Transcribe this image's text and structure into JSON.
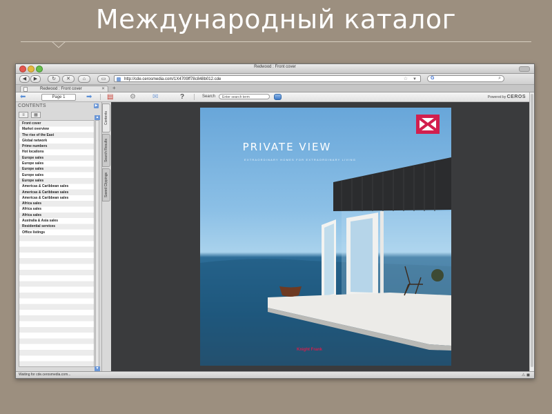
{
  "slide": {
    "title": "Международный каталог"
  },
  "browser": {
    "window_title": "Redwood : Front cover",
    "url": "http://cde.cerosmedia.com/1X4709ff78c848b012.cde",
    "tab_title": "Redwood : Front cover",
    "status": "Waiting for cde.cerosmedia.com..."
  },
  "toolbar": {
    "page_field": "Page 1",
    "search_label": "Search",
    "search_placeholder": "Enter search term",
    "powered_by": "Powered by",
    "powered_brand": "CEROS"
  },
  "sidebar": {
    "heading": "CONTENTS",
    "items": [
      "Front cover",
      "Market overview",
      "The rise of the East",
      "Global network",
      "Prime numbers",
      "Hot locations",
      "Europe sales",
      "Europe sales",
      "Europe sales",
      "Europe sales",
      "Europe sales",
      "Americas & Caribbean sales",
      "Americas & Caribbean sales",
      "Americas & Caribbean sales",
      "Africa sales",
      "Africa sales",
      "Africa sales",
      "Australia & Asia sales",
      "Residential services",
      "Office listings"
    ],
    "vertical_tabs": [
      "Contents",
      "Search Results",
      "Saved Clippings"
    ]
  },
  "cover": {
    "title": "PRIVATE VIEW",
    "subtitle": "EXTRAORDINARY HOMES FOR EXTRAORDINARY LIVING",
    "brand": "Knight Frank"
  },
  "colors": {
    "slide_bg": "#9c8f7f",
    "brand_red": "#d21f4e",
    "viewer_bg": "#3a3b3d"
  }
}
